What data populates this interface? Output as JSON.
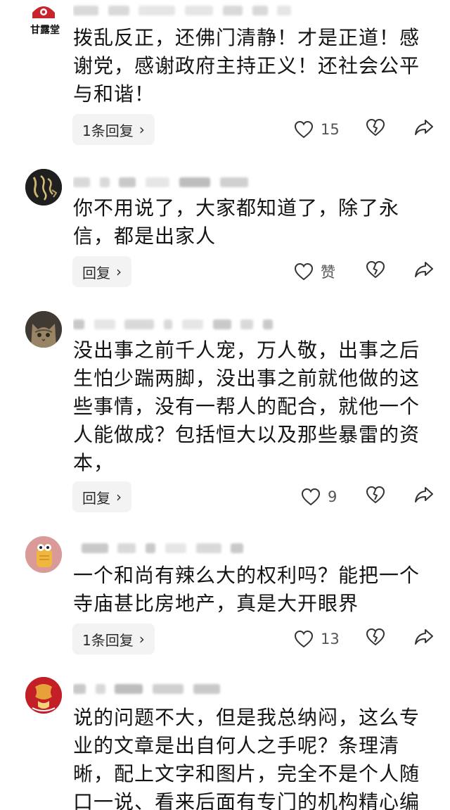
{
  "comments": [
    {
      "meta_name": "",
      "text": "拨乱反正，还佛门清静！才是正道！感谢党，感谢政府主持正义！还社会公平与和谐！",
      "reply_label": "1条回复",
      "like_count": "15",
      "avatar_icon": "ganlutang-logo-icon",
      "avatar_text": "甘露堂"
    },
    {
      "meta_name": "",
      "text": "你不用说了，大家都知道了，除了永信，都是出家人",
      "reply_label": "回复",
      "like_count": "赞",
      "avatar_icon": "calligraphy-avatar-icon",
      "avatar_text": ""
    },
    {
      "meta_name": "",
      "text": "没出事之前千人宠，万人敬，出事之后生怕少踹两脚，没出事之前就他做的这些事情，没有一帮人的配合，就他一个人能做成？包括恒大以及那些暴雷的资本，",
      "reply_label": "回复",
      "like_count": "9",
      "avatar_icon": "cat-avatar-icon",
      "avatar_text": ""
    },
    {
      "meta_name": "",
      "text": "一个和尚有辣么大的权利吗？能把一个寺庙甚比房地产，真是大开眼界",
      "reply_label": "1条回复",
      "like_count": "13",
      "avatar_icon": "cartoon-avatar-icon",
      "avatar_text": ""
    },
    {
      "meta_name": "",
      "text": "说的问题不大，但是我总纳闷，这么专业的文章是出自何人之手呢？条理清晰，配上文字和图片，完全不是个人随口一说、看来后面有专门的机构精心编",
      "reply_label": "",
      "like_count": "",
      "avatar_icon": "red-seal-avatar-icon",
      "avatar_text": ""
    }
  ],
  "icons": {
    "like": "heart-outline-icon",
    "dislike": "broken-heart-icon",
    "share": "share-arrow-icon",
    "chevron": "chevron-right-icon"
  },
  "colors": {
    "reply_bg": "#f3f3f3",
    "text": "#141414",
    "muted": "#9a9a9a",
    "logo_red": "#c8242b"
  }
}
